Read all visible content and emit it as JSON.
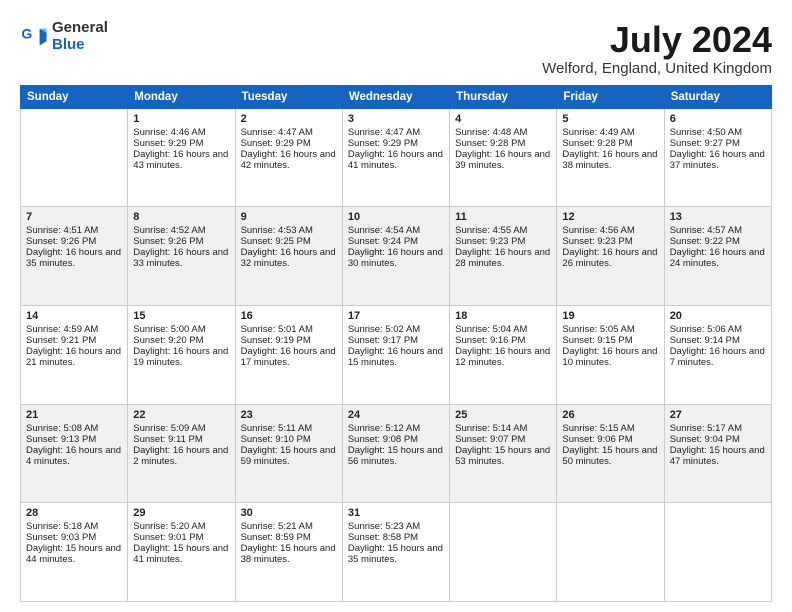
{
  "header": {
    "logo_line1": "General",
    "logo_line2": "Blue",
    "month": "July 2024",
    "location": "Welford, England, United Kingdom"
  },
  "days_of_week": [
    "Sunday",
    "Monday",
    "Tuesday",
    "Wednesday",
    "Thursday",
    "Friday",
    "Saturday"
  ],
  "weeks": [
    [
      {
        "day": "",
        "sunrise": "",
        "sunset": "",
        "daylight": ""
      },
      {
        "day": "1",
        "sunrise": "Sunrise: 4:46 AM",
        "sunset": "Sunset: 9:29 PM",
        "daylight": "Daylight: 16 hours and 43 minutes."
      },
      {
        "day": "2",
        "sunrise": "Sunrise: 4:47 AM",
        "sunset": "Sunset: 9:29 PM",
        "daylight": "Daylight: 16 hours and 42 minutes."
      },
      {
        "day": "3",
        "sunrise": "Sunrise: 4:47 AM",
        "sunset": "Sunset: 9:29 PM",
        "daylight": "Daylight: 16 hours and 41 minutes."
      },
      {
        "day": "4",
        "sunrise": "Sunrise: 4:48 AM",
        "sunset": "Sunset: 9:28 PM",
        "daylight": "Daylight: 16 hours and 39 minutes."
      },
      {
        "day": "5",
        "sunrise": "Sunrise: 4:49 AM",
        "sunset": "Sunset: 9:28 PM",
        "daylight": "Daylight: 16 hours and 38 minutes."
      },
      {
        "day": "6",
        "sunrise": "Sunrise: 4:50 AM",
        "sunset": "Sunset: 9:27 PM",
        "daylight": "Daylight: 16 hours and 37 minutes."
      }
    ],
    [
      {
        "day": "7",
        "sunrise": "Sunrise: 4:51 AM",
        "sunset": "Sunset: 9:26 PM",
        "daylight": "Daylight: 16 hours and 35 minutes."
      },
      {
        "day": "8",
        "sunrise": "Sunrise: 4:52 AM",
        "sunset": "Sunset: 9:26 PM",
        "daylight": "Daylight: 16 hours and 33 minutes."
      },
      {
        "day": "9",
        "sunrise": "Sunrise: 4:53 AM",
        "sunset": "Sunset: 9:25 PM",
        "daylight": "Daylight: 16 hours and 32 minutes."
      },
      {
        "day": "10",
        "sunrise": "Sunrise: 4:54 AM",
        "sunset": "Sunset: 9:24 PM",
        "daylight": "Daylight: 16 hours and 30 minutes."
      },
      {
        "day": "11",
        "sunrise": "Sunrise: 4:55 AM",
        "sunset": "Sunset: 9:23 PM",
        "daylight": "Daylight: 16 hours and 28 minutes."
      },
      {
        "day": "12",
        "sunrise": "Sunrise: 4:56 AM",
        "sunset": "Sunset: 9:23 PM",
        "daylight": "Daylight: 16 hours and 26 minutes."
      },
      {
        "day": "13",
        "sunrise": "Sunrise: 4:57 AM",
        "sunset": "Sunset: 9:22 PM",
        "daylight": "Daylight: 16 hours and 24 minutes."
      }
    ],
    [
      {
        "day": "14",
        "sunrise": "Sunrise: 4:59 AM",
        "sunset": "Sunset: 9:21 PM",
        "daylight": "Daylight: 16 hours and 21 minutes."
      },
      {
        "day": "15",
        "sunrise": "Sunrise: 5:00 AM",
        "sunset": "Sunset: 9:20 PM",
        "daylight": "Daylight: 16 hours and 19 minutes."
      },
      {
        "day": "16",
        "sunrise": "Sunrise: 5:01 AM",
        "sunset": "Sunset: 9:19 PM",
        "daylight": "Daylight: 16 hours and 17 minutes."
      },
      {
        "day": "17",
        "sunrise": "Sunrise: 5:02 AM",
        "sunset": "Sunset: 9:17 PM",
        "daylight": "Daylight: 16 hours and 15 minutes."
      },
      {
        "day": "18",
        "sunrise": "Sunrise: 5:04 AM",
        "sunset": "Sunset: 9:16 PM",
        "daylight": "Daylight: 16 hours and 12 minutes."
      },
      {
        "day": "19",
        "sunrise": "Sunrise: 5:05 AM",
        "sunset": "Sunset: 9:15 PM",
        "daylight": "Daylight: 16 hours and 10 minutes."
      },
      {
        "day": "20",
        "sunrise": "Sunrise: 5:06 AM",
        "sunset": "Sunset: 9:14 PM",
        "daylight": "Daylight: 16 hours and 7 minutes."
      }
    ],
    [
      {
        "day": "21",
        "sunrise": "Sunrise: 5:08 AM",
        "sunset": "Sunset: 9:13 PM",
        "daylight": "Daylight: 16 hours and 4 minutes."
      },
      {
        "day": "22",
        "sunrise": "Sunrise: 5:09 AM",
        "sunset": "Sunset: 9:11 PM",
        "daylight": "Daylight: 16 hours and 2 minutes."
      },
      {
        "day": "23",
        "sunrise": "Sunrise: 5:11 AM",
        "sunset": "Sunset: 9:10 PM",
        "daylight": "Daylight: 15 hours and 59 minutes."
      },
      {
        "day": "24",
        "sunrise": "Sunrise: 5:12 AM",
        "sunset": "Sunset: 9:08 PM",
        "daylight": "Daylight: 15 hours and 56 minutes."
      },
      {
        "day": "25",
        "sunrise": "Sunrise: 5:14 AM",
        "sunset": "Sunset: 9:07 PM",
        "daylight": "Daylight: 15 hours and 53 minutes."
      },
      {
        "day": "26",
        "sunrise": "Sunrise: 5:15 AM",
        "sunset": "Sunset: 9:06 PM",
        "daylight": "Daylight: 15 hours and 50 minutes."
      },
      {
        "day": "27",
        "sunrise": "Sunrise: 5:17 AM",
        "sunset": "Sunset: 9:04 PM",
        "daylight": "Daylight: 15 hours and 47 minutes."
      }
    ],
    [
      {
        "day": "28",
        "sunrise": "Sunrise: 5:18 AM",
        "sunset": "Sunset: 9:03 PM",
        "daylight": "Daylight: 15 hours and 44 minutes."
      },
      {
        "day": "29",
        "sunrise": "Sunrise: 5:20 AM",
        "sunset": "Sunset: 9:01 PM",
        "daylight": "Daylight: 15 hours and 41 minutes."
      },
      {
        "day": "30",
        "sunrise": "Sunrise: 5:21 AM",
        "sunset": "Sunset: 8:59 PM",
        "daylight": "Daylight: 15 hours and 38 minutes."
      },
      {
        "day": "31",
        "sunrise": "Sunrise: 5:23 AM",
        "sunset": "Sunset: 8:58 PM",
        "daylight": "Daylight: 15 hours and 35 minutes."
      },
      {
        "day": "",
        "sunrise": "",
        "sunset": "",
        "daylight": ""
      },
      {
        "day": "",
        "sunrise": "",
        "sunset": "",
        "daylight": ""
      },
      {
        "day": "",
        "sunrise": "",
        "sunset": "",
        "daylight": ""
      }
    ]
  ]
}
